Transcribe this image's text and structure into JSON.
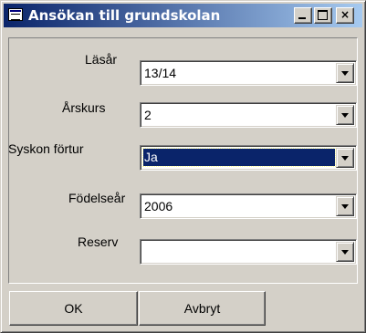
{
  "window": {
    "title": "Ansökan till grundskolan",
    "icon": "form-icon",
    "controls": {
      "minimize": "",
      "maximize": "",
      "close": "×"
    }
  },
  "form": {
    "fields": [
      {
        "label": "Läsår",
        "value": "13/14"
      },
      {
        "label": "Årskurs",
        "value": "2"
      },
      {
        "label": "Syskon förtur",
        "value": "Ja",
        "selected": true
      },
      {
        "label": "Födelseår",
        "value": "2006"
      },
      {
        "label": "Reserv",
        "value": ""
      }
    ]
  },
  "buttons": {
    "ok": "OK",
    "cancel": "Avbryt"
  },
  "colors": {
    "titlebar_start": "#0a246a",
    "titlebar_end": "#a6caf0",
    "selection": "#0a246a",
    "face": "#d4d0c8"
  }
}
